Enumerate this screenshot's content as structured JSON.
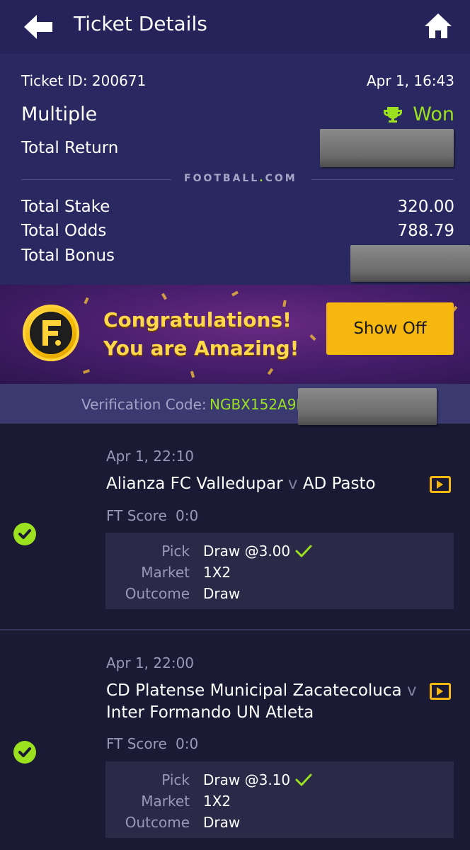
{
  "header": {
    "title": "Ticket Details",
    "back_icon": "arrow-left-icon",
    "home_icon": "home-icon"
  },
  "ticket": {
    "id_label": "Ticket ID: 200671",
    "date": "Apr 1, 16:43",
    "type": "Multiple",
    "status": "Won",
    "total_return_label": "Total Return",
    "brand": "FOOTBALL",
    "brand_suffix": "COM",
    "total_stake_label": "Total Stake",
    "total_stake": "320.00",
    "total_odds_label": "Total Odds",
    "total_odds": "788.79",
    "total_bonus_label": "Total Bonus"
  },
  "banner": {
    "line1": "Congratulations!",
    "line2": "You are Amazing!",
    "button": "Show Off"
  },
  "verification": {
    "label": "Verification Code:",
    "code": "NGBX152A9I"
  },
  "events": [
    {
      "date": "Apr 1, 22:10",
      "home": "Alianza FC Valledupar",
      "vs": "v",
      "away": "AD Pasto",
      "ft_label": "FT Score",
      "ft_score": "0:0",
      "pick_label": "Pick",
      "pick": "Draw @3.00",
      "market_label": "Market",
      "market": "1X2",
      "outcome_label": "Outcome",
      "outcome": "Draw"
    },
    {
      "date": "Apr 1, 22:00",
      "home": "CD Platense Municipal Zacatecoluca",
      "vs": "v",
      "away": "Inter Formando UN Atleta",
      "ft_label": "FT Score",
      "ft_score": "0:0",
      "pick_label": "Pick",
      "pick": "Draw @3.10",
      "market_label": "Market",
      "market": "1X2",
      "outcome_label": "Outcome",
      "outcome": "Draw"
    }
  ],
  "colors": {
    "accent_green": "#9be11f",
    "accent_yellow": "#f6b70f",
    "header_bg": "#252359",
    "summary_bg": "#2a2860",
    "page_bg": "#1a1a35"
  }
}
